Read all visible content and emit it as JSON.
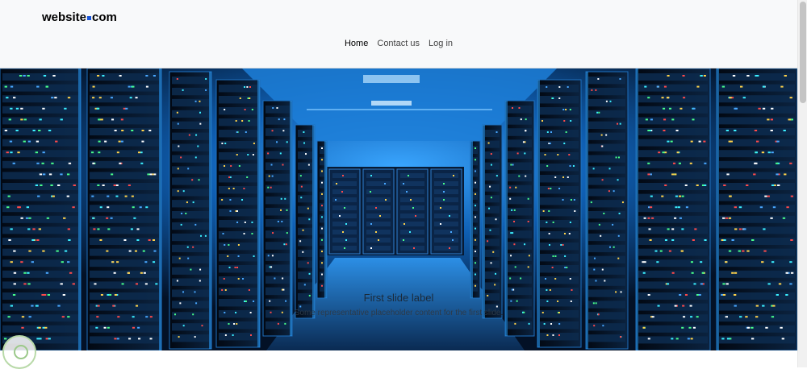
{
  "brand": {
    "name_before": "website",
    "name_after": "com"
  },
  "nav": {
    "items": [
      "Home",
      "Contact us",
      "Log in"
    ]
  },
  "carousel": {
    "caption_title": "First slide label",
    "caption_text": "Some representative placeholder content for the first slide."
  },
  "colors": {
    "accent": "#1a56db",
    "navbar_bg": "#f8f9fa",
    "slide_glow": "#1e90ff"
  }
}
